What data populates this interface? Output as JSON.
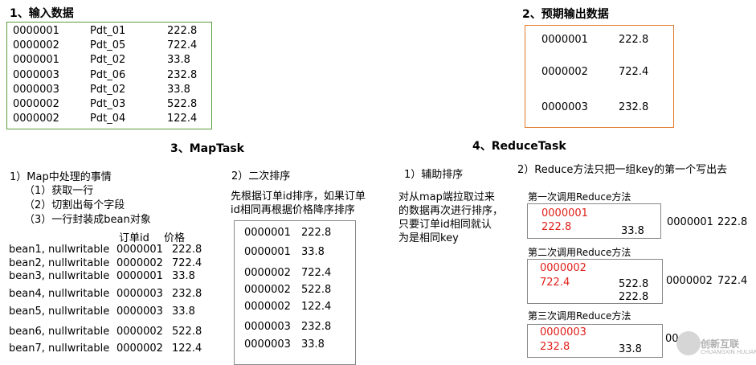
{
  "input": {
    "title": "1、输入数据",
    "rows": [
      [
        "0000001",
        "Pdt_01",
        "222.8"
      ],
      [
        "0000002",
        "Pdt_05",
        "722.4"
      ],
      [
        "0000001",
        "Pdt_02",
        "33.8"
      ],
      [
        "0000003",
        "Pdt_06",
        "232.8"
      ],
      [
        "0000003",
        "Pdt_02",
        "33.8"
      ],
      [
        "0000002",
        "Pdt_03",
        "522.8"
      ],
      [
        "0000002",
        "Pdt_04",
        "122.4"
      ]
    ]
  },
  "expected": {
    "title": "2、预期输出数据",
    "rows": [
      [
        "0000001",
        "222.8"
      ],
      [
        "0000002",
        "722.4"
      ],
      [
        "0000003",
        "232.8"
      ]
    ]
  },
  "maptask": {
    "title": "3、MapTask",
    "step1_title": "1）Map中处理的事情",
    "step1_items": [
      "（1）获取一行",
      "（2）切割出每个字段",
      "（3）一行封装成bean对象"
    ],
    "col_order_id": "订单id",
    "col_price": "价格",
    "beans": [
      [
        "bean1, nullwritable",
        "0000001",
        "222.8"
      ],
      [
        "bean2, nullwritable",
        "0000002",
        "722.4"
      ],
      [
        "bean3, nullwritable",
        "0000001",
        "33.8"
      ],
      [
        "bean4, nullwritable",
        "0000003",
        "232.8"
      ],
      [
        "bean5, nullwritable",
        "0000003",
        "33.8"
      ],
      [
        "bean6, nullwritable",
        "0000002",
        "522.8"
      ],
      [
        "bean7, nullwritable",
        "0000002",
        "122.4"
      ]
    ],
    "step2_title": "2）二次排序",
    "step2_desc": [
      "先根据订单id排序，如果订单",
      "id相同再根据价格降序排序"
    ],
    "sorted": [
      [
        "0000001",
        "222.8"
      ],
      [
        "0000001",
        "33.8"
      ],
      [
        "0000002",
        "722.4"
      ],
      [
        "0000002",
        "522.8"
      ],
      [
        "0000002",
        "122.4"
      ],
      [
        "0000003",
        "232.8"
      ],
      [
        "0000003",
        "33.8"
      ]
    ]
  },
  "reducetask": {
    "title": "4、ReduceTask",
    "step1_title": "1）辅助排序",
    "step1_desc": [
      "对从map端拉取过来",
      "的数据再次进行排序，",
      "只要订单id相同就认",
      "为是相同key"
    ],
    "step2_title": "2）Reduce方法只把一组key的第一个写出去",
    "calls": [
      {
        "label": "第一次调用Reduce方法",
        "key": "0000001",
        "first": "222.8",
        "others": [
          "33.8"
        ],
        "output": [
          "0000001",
          "222.8"
        ]
      },
      {
        "label": "第二次调用Reduce方法",
        "key": "0000002",
        "first": "722.4",
        "others": [
          "522.8",
          "222.8"
        ],
        "output": [
          "0000002",
          "722.4"
        ]
      },
      {
        "label": "第三次调用Reduce方法",
        "key": "0000003",
        "first": "232.8",
        "others": [
          "33.8"
        ],
        "output": [
          "00"
        ]
      }
    ]
  },
  "watermark": {
    "name": "创新互联",
    "sub": "CHUANGXIN HULIAN"
  },
  "colors": {
    "input_border": "#5a9b3c",
    "expected_border": "#e07b2e",
    "red": "#e0201a",
    "gray_border": "#888888"
  }
}
